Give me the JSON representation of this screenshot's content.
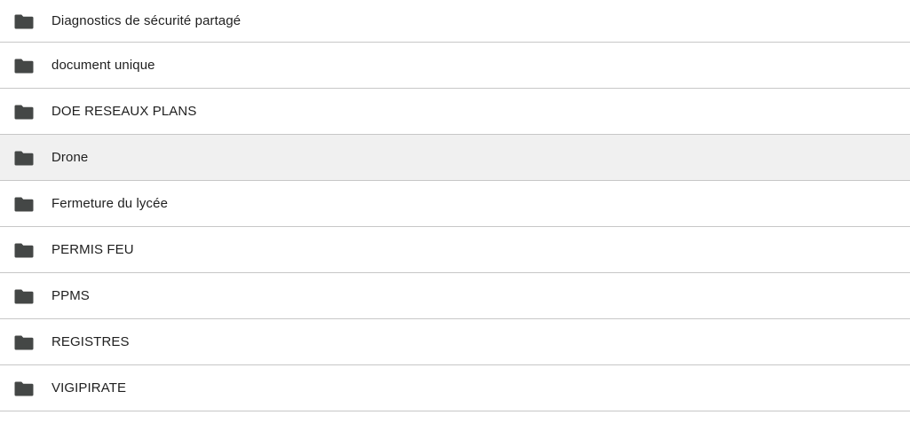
{
  "folders": [
    {
      "name": "Diagnostics de sécurité partagé",
      "icon": "folder-icon",
      "selected": false
    },
    {
      "name": "document unique",
      "icon": "folder-icon",
      "selected": false
    },
    {
      "name": "DOE RESEAUX PLANS",
      "icon": "folder-icon",
      "selected": false
    },
    {
      "name": "Drone",
      "icon": "folder-icon",
      "selected": true
    },
    {
      "name": "Fermeture du lycée",
      "icon": "folder-icon",
      "selected": false
    },
    {
      "name": "PERMIS FEU",
      "icon": "folder-icon",
      "selected": false
    },
    {
      "name": "PPMS",
      "icon": "folder-icon",
      "selected": false
    },
    {
      "name": "REGISTRES",
      "icon": "folder-icon",
      "selected": false
    },
    {
      "name": "VIGIPIRATE",
      "icon": "folder-icon",
      "selected": false
    }
  ],
  "colors": {
    "icon": "#444746",
    "text": "#1f1f1f",
    "divider": "#c7c7c7",
    "selected_row": "#f0f0f0"
  }
}
